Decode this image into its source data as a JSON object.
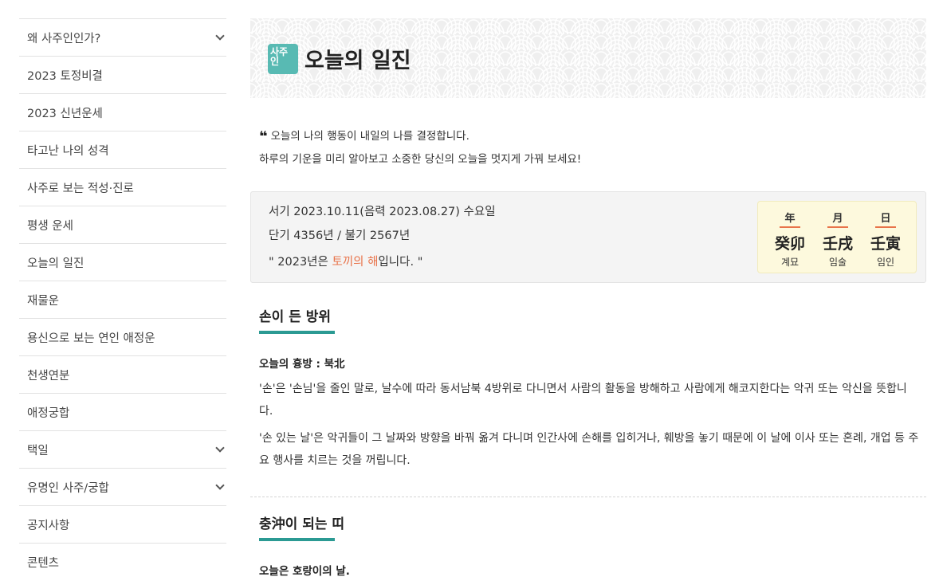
{
  "sidebar": {
    "items": [
      {
        "label": "왜 사주인인가?",
        "expandable": true
      },
      {
        "label": "2023 토정비결",
        "expandable": false
      },
      {
        "label": "2023 신년운세",
        "expandable": false
      },
      {
        "label": "타고난 나의 성격",
        "expandable": false
      },
      {
        "label": "사주로 보는 적성·진로",
        "expandable": false
      },
      {
        "label": "평생 운세",
        "expandable": false
      },
      {
        "label": "오늘의 일진",
        "expandable": false
      },
      {
        "label": "재물운",
        "expandable": false
      },
      {
        "label": "용신으로 보는 연인 애정운",
        "expandable": false
      },
      {
        "label": "천생연분",
        "expandable": false
      },
      {
        "label": "애정궁합",
        "expandable": false
      },
      {
        "label": "택일",
        "expandable": true
      },
      {
        "label": "유명인 사주/궁합",
        "expandable": true
      },
      {
        "label": "공지사항",
        "expandable": false
      },
      {
        "label": "콘텐츠",
        "expandable": false
      }
    ]
  },
  "banner": {
    "logo_line1": "사주",
    "logo_line2": "인",
    "title": "오늘의 일진"
  },
  "intro": {
    "quote_icon": "❝",
    "line1": "오늘의 나의 행동이 내일의 나를 결정합니다.",
    "line2": "하루의 기운을 미리 알아보고 소중한 당신의 오늘을 멋지게 가꿔 보세요!"
  },
  "date": {
    "line1": "서기 2023.10.11(음력 2023.08.27) 수요일",
    "line2": "단기 4356년 / 불기 2567년",
    "line3_prefix": "\" 2023년은 ",
    "line3_highlight": "토끼의 해",
    "line3_suffix": "입니다. \""
  },
  "ganji": {
    "columns": [
      {
        "header": "年",
        "value": "癸卯",
        "reading": "계묘"
      },
      {
        "header": "月",
        "value": "壬戌",
        "reading": "임술"
      },
      {
        "header": "日",
        "value": "壬寅",
        "reading": "임인"
      }
    ]
  },
  "section1": {
    "title": "손이 든 방위",
    "sub": "오늘의 흉방 : 북北",
    "para1": "'손'은 '손님'을 줄인 말로, 날수에 따라 동서남북 4방위로 다니면서 사람의 활동을 방해하고 사람에게 해코지한다는 악귀 또는 악신을 뜻합니다.",
    "para2": "'손 있는 날'은 악귀들이 그 날짜와 방향을 바꿔 옮겨 다니며 인간사에 손해를 입히거나, 훼방을 놓기 때문에 이 날에 이사 또는 혼례, 개업 등 주요 행사를 치르는 것을 꺼립니다."
  },
  "section2": {
    "title": "충沖이 되는 띠",
    "sub": "오늘은 호랑이의 날."
  },
  "colors": {
    "accent": "#2b9a93",
    "highlight": "#e8734a",
    "ganji_bg": "#fdf9dd",
    "logo": "#58bab3"
  }
}
